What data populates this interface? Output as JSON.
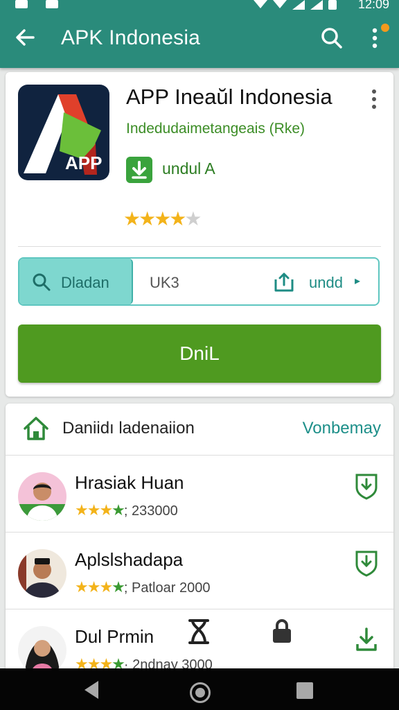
{
  "status_bar": {
    "time": "12:09"
  },
  "header": {
    "title": "APK Indonesia"
  },
  "app": {
    "name": "APP Ineaŭl Indonesia",
    "icon_label": "APP",
    "developer": "Indedudaimetangeais (Rke)",
    "download_label": "undul A",
    "rating": "★★★★",
    "rating_off": "★",
    "rating_value": 4
  },
  "segments": {
    "first": "Dladan",
    "second": "UK3",
    "third": "undd",
    "third_arrow": "▸"
  },
  "primary_button": "DniL",
  "section": {
    "title": "Daniidı ladenaiion",
    "link": "Vonbemay"
  },
  "list": [
    {
      "name": "Hrasiak Huan",
      "stars": "★★★",
      "partial": "★",
      "count": "; 233000"
    },
    {
      "name": "Aplslshadapa",
      "stars": "★★★",
      "partial": "★",
      "count": "; Patloar 2000"
    },
    {
      "name": "Dul Prmin",
      "stars": "★★★",
      "partial": "★",
      "count": "· 2ndnay 3000"
    }
  ],
  "colors": {
    "toolbar": "#2a8b7b",
    "accent_green": "#4f9a20",
    "teal": "#5ec6c0",
    "star": "#f3b31a"
  }
}
